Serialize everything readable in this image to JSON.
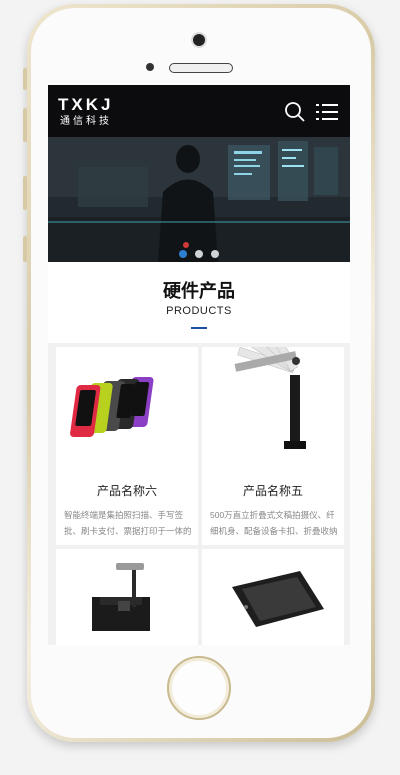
{
  "header": {
    "logo_main": "TXKJ",
    "logo_sub": "通信科技"
  },
  "banner": {
    "slide_count": 3,
    "active_slide": 1
  },
  "section": {
    "title": "硬件产品",
    "subtitle": "PRODUCTS"
  },
  "products": [
    {
      "title": "产品名称六",
      "desc": "智能终端是集拍照扫描、手写签批、刷卡支付、票据打印于一体的"
    },
    {
      "title": "产品名称五",
      "desc": "500万直立折叠式文稿拍摄仪、纤细机身、配备设备卡扣、折叠收纳"
    },
    {
      "title": "",
      "desc": ""
    },
    {
      "title": "",
      "desc": ""
    }
  ],
  "colors": {
    "accent": "#1d4fa3",
    "header_bg": "#0c0c0e",
    "active_dot": "#2f7fd0"
  }
}
